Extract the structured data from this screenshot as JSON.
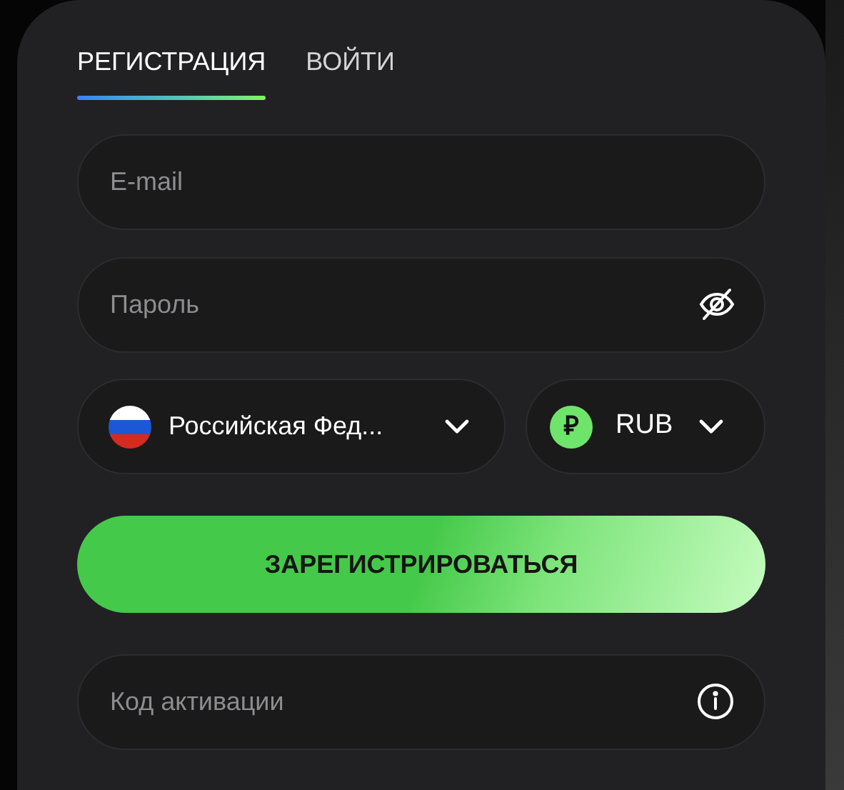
{
  "tabs": [
    {
      "label": "РЕГИСТРАЦИЯ",
      "selected": true
    },
    {
      "label": "ВОЙТИ",
      "selected": false
    }
  ],
  "email": {
    "placeholder": "E-mail"
  },
  "password": {
    "placeholder": "Пароль"
  },
  "country": {
    "value": "Российская Фед..."
  },
  "currency": {
    "symbol": "₽",
    "value": "RUB"
  },
  "submit": "ЗАРЕГИСТРИРОВАТЬСЯ",
  "promo": {
    "placeholder": "Код активации"
  }
}
